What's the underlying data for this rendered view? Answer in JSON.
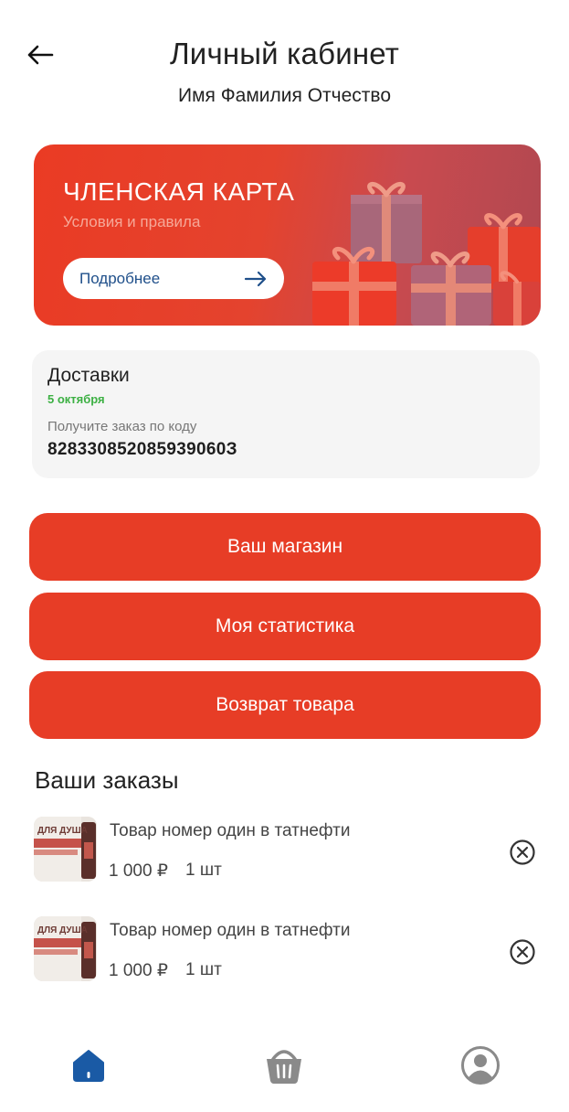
{
  "header": {
    "title": "Личный кабинет",
    "user_name": "Имя Фамилия Отчество",
    "back_icon": "arrow-left-icon"
  },
  "membership_card": {
    "title": "ЧЛЕНСКАЯ КАРТА",
    "subtitle": "Условия и правила",
    "more_label": "Подробнее",
    "colors": {
      "background": "#e73d26",
      "button_text": "#1f4f8a"
    }
  },
  "delivery": {
    "title": "Доставки",
    "date": "5 октября",
    "hint": "Получите заказ по коду",
    "code": "828330852085939060З"
  },
  "actions": [
    {
      "label": "Ваш магазин"
    },
    {
      "label": "Моя статистика"
    },
    {
      "label": "Возврат товара"
    }
  ],
  "orders": {
    "title": "Ваши заказы",
    "items": [
      {
        "name": "Товар номер один в татнефти",
        "price": "1 000 ₽",
        "qty": "1 шт",
        "thumb_text": "ДЛЯ ДУША"
      },
      {
        "name": "Товар номер один в татнефти",
        "price": "1 000 ₽",
        "qty": "1 шт",
        "thumb_text": "ДЛЯ ДУША"
      }
    ]
  },
  "tabbar": {
    "items": [
      {
        "icon": "home-icon",
        "active": true
      },
      {
        "icon": "basket-icon",
        "active": false
      },
      {
        "icon": "profile-icon",
        "active": false
      }
    ],
    "colors": {
      "active": "#1a5aa5",
      "inactive": "#8a8a8a"
    }
  }
}
